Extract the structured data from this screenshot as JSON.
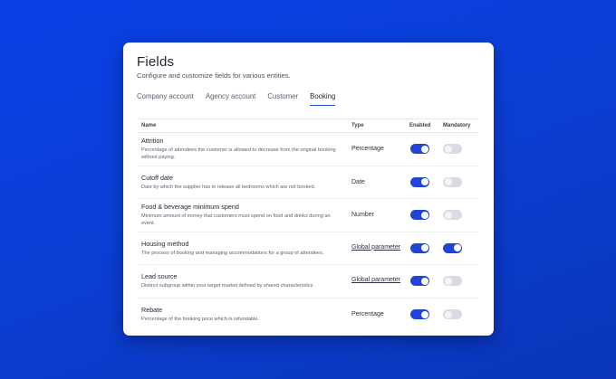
{
  "header": {
    "title": "Fields",
    "subtitle": "Configure and customize fields for various entities."
  },
  "tabs": [
    {
      "label": "Company account",
      "active": false
    },
    {
      "label": "Agency account",
      "active": false
    },
    {
      "label": "Customer",
      "active": false
    },
    {
      "label": "Booking",
      "active": true
    }
  ],
  "table": {
    "columns": {
      "name": "Name",
      "type": "Type",
      "enabled": "Enabled",
      "mandatory": "Mandatory"
    },
    "rows": [
      {
        "name": "Attrition",
        "description": "Percentage of attendees the customer is allowed to decrease from the original booking without paying.",
        "type": "Percentage",
        "type_is_link": false,
        "enabled": true,
        "mandatory": false
      },
      {
        "name": "Cutoff date",
        "description": "Date by which the supplier has to release all bedrooms which are not booked.",
        "type": "Date",
        "type_is_link": false,
        "enabled": true,
        "mandatory": false
      },
      {
        "name": "Food & beverage minimum spend",
        "description": "Minimum amount of money that customers must spend on food and drinks during an event.",
        "type": "Number",
        "type_is_link": false,
        "enabled": true,
        "mandatory": false
      },
      {
        "name": "Housing method",
        "description": "The process of booking and managing accommodations for a group of attendees.",
        "type": "Global parameter",
        "type_is_link": true,
        "enabled": true,
        "mandatory": true
      },
      {
        "name": "Lead source",
        "description": "Distinct subgroup within your target market defined by shared characteristics",
        "type": "Global parameter",
        "type_is_link": true,
        "enabled": true,
        "mandatory": false
      },
      {
        "name": "Rebate",
        "description": "Percentage of the booking price which is refundable.",
        "type": "Percentage",
        "type_is_link": false,
        "enabled": true,
        "mandatory": false
      }
    ]
  },
  "colors": {
    "background": "#0a40e6",
    "accent": "#2045d6",
    "toggle_off": "#d8dbe2"
  }
}
